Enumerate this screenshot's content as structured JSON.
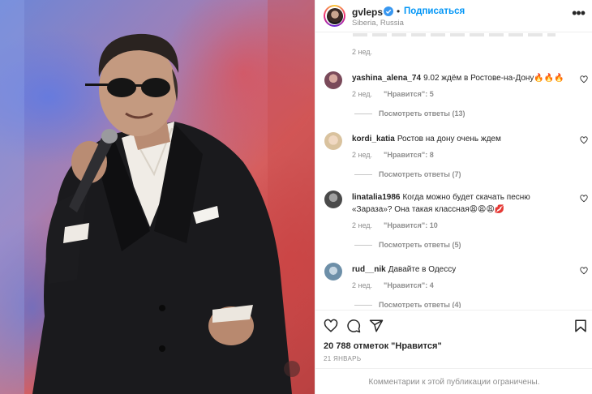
{
  "post": {
    "image_alt": "Singer in dark suit and sunglasses performing with microphone on stage"
  },
  "header": {
    "username": "gvleps",
    "separator": "•",
    "follow_label": "Подписаться",
    "location": "Siberia, Russia",
    "more_icon": "more-horizontal-icon"
  },
  "comments": {
    "top_partial_time": "2 нед.",
    "items": [
      {
        "username": "yashina_alena_74",
        "text": "9.02 ждём в Ростове-на-Дону🔥🔥🔥",
        "time": "2 нед.",
        "likes": "\"Нравится\": 5",
        "replies": "Посмотреть ответы (13)",
        "avatar_color": "#7a4a5a"
      },
      {
        "username": "kordi_katia",
        "text": "Ростов на дону очень ждем",
        "time": "2 нед.",
        "likes": "\"Нравится\": 8",
        "replies": "Посмотреть ответы (7)",
        "avatar_color": "#e8d6b8"
      },
      {
        "username": "linatalia1986",
        "text": "Когда можно будет скачать песню «Зараза»? Она такая классная😩😩😩💋",
        "time": "2 нед.",
        "likes": "\"Нравится\": 10",
        "replies": "Посмотреть ответы (5)",
        "avatar_color": "#5a5a5a"
      },
      {
        "username": "rud__nik",
        "text": "Давайте в Одессу",
        "time": "2 нед.",
        "likes": "\"Нравится\": 4",
        "replies": "Посмотреть ответы (4)",
        "avatar_color": "#6d8fa8"
      }
    ]
  },
  "actions": {
    "like_icon": "heart-icon",
    "comment_icon": "comment-icon",
    "share_icon": "send-icon",
    "save_icon": "bookmark-icon"
  },
  "likes_count": "20 788 отметок \"Нравится\"",
  "date": "21 ЯНВАРЬ",
  "comments_closed": "Комментарии к этой публикации ограничены.",
  "colors": {
    "accent": "#0095f6",
    "text": "#262626",
    "secondary": "#8e8e8e"
  }
}
